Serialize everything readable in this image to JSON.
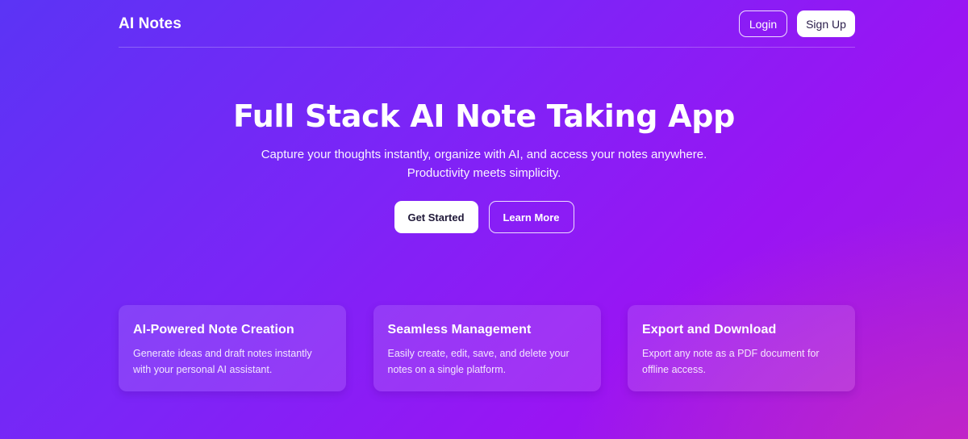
{
  "header": {
    "logo": "AI Notes",
    "login_label": "Login",
    "signup_label": "Sign Up"
  },
  "hero": {
    "title": "Full Stack AI Note Taking App",
    "subtitle": "Capture your thoughts instantly, organize with AI, and access your notes anywhere. Productivity meets simplicity.",
    "primary_cta": "Get Started",
    "secondary_cta": "Learn More"
  },
  "features": [
    {
      "title": "AI-Powered Note Creation",
      "description": "Generate ideas and draft notes instantly with your personal AI assistant."
    },
    {
      "title": "Seamless Management",
      "description": "Easily create, edit, save, and delete your notes on a single platform."
    },
    {
      "title": "Export and Download",
      "description": "Export any note as a PDF document for offline access."
    }
  ],
  "colors": {
    "gradient_start": "#5b34f5",
    "gradient_mid": "#9a14f3",
    "gradient_end_accent": "#cd28be",
    "text": "#ffffff"
  }
}
